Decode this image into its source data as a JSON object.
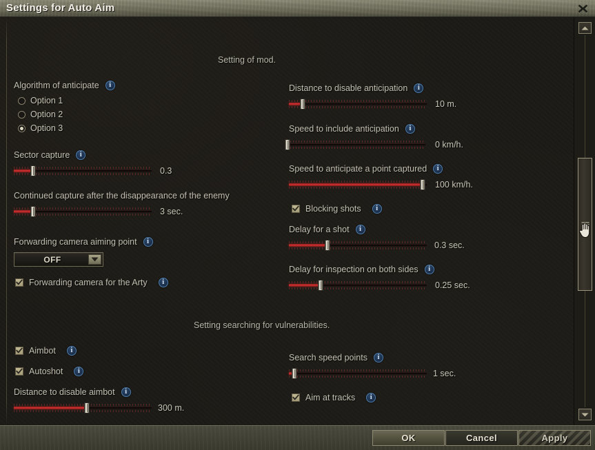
{
  "window": {
    "title": "Settings for Auto Aim",
    "close_icon": "close-icon"
  },
  "sections": {
    "mod_heading": "Setting of mod.",
    "vuln_heading": "Setting searching for vulnerabilities."
  },
  "controls": {
    "algorithm": {
      "label": "Algorithm of anticipate",
      "options": [
        "Option 1",
        "Option 2",
        "Option 3"
      ],
      "selected_index": 2
    },
    "sector_capture": {
      "label": "Sector capture",
      "value": "0.3",
      "fill_percent": 14
    },
    "continued_capture": {
      "label": "Continued capture after the disappearance of the enemy",
      "value": "3 sec.",
      "fill_percent": 14
    },
    "forwarding_camera_point": {
      "label": "Forwarding camera aiming point",
      "value": "OFF"
    },
    "forwarding_camera_arty": {
      "label": "Forwarding camera for the Arty",
      "checked": true
    },
    "distance_disable_anticipation": {
      "label": "Distance to disable anticipation",
      "value": "10 m.",
      "fill_percent": 10
    },
    "speed_include_anticipation": {
      "label": "Speed to include anticipation",
      "value": "0 km/h.",
      "fill_percent": 0
    },
    "speed_anticipate_point": {
      "label": "Speed to anticipate a point captured",
      "value": "100 km/h.",
      "fill_percent": 97
    },
    "blocking_shots": {
      "label": "Blocking shots",
      "checked": true
    },
    "delay_for_shot": {
      "label": "Delay for a shot",
      "value": "0.3 sec.",
      "fill_percent": 28
    },
    "delay_inspection": {
      "label": "Delay for inspection on both sides",
      "value": "0.25 sec.",
      "fill_percent": 23
    },
    "aimbot": {
      "label": "Aimbot",
      "checked": true
    },
    "autoshot": {
      "label": "Autoshot",
      "checked": true
    },
    "distance_disable_aimbot": {
      "label": "Distance to disable aimbot",
      "value": "300 m.",
      "fill_percent": 53
    },
    "search_speed_points": {
      "label": "Search speed points",
      "value": "1 sec.",
      "fill_percent": 4
    },
    "aim_at_tracks": {
      "label": "Aim at tracks",
      "checked": true
    }
  },
  "scrollbar": {
    "up_icon": "chevron-up-icon",
    "down_icon": "chevron-down-icon",
    "thumb_icon": "scrollbar-thumb-grip"
  },
  "footer": {
    "ok": "OK",
    "cancel": "Cancel",
    "apply": "Apply"
  }
}
